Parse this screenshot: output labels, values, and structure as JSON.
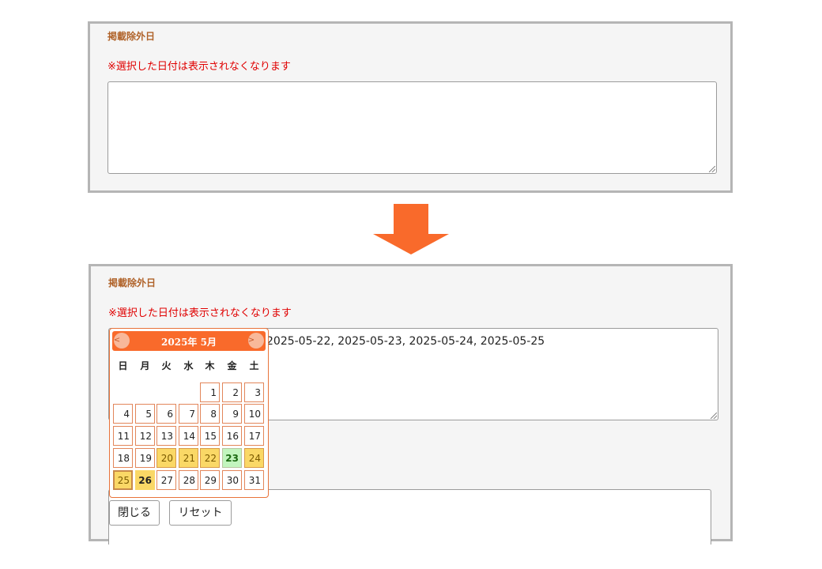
{
  "top_panel": {
    "label": "掲載除外日",
    "note": "※選択した日付は表示されなくなります",
    "textarea_value": ""
  },
  "bottom_panel": {
    "label": "掲載除外日",
    "note": "※選択した日付は表示されなくなります",
    "textarea_value": "2025-05-22, 2025-05-23, 2025-05-24, 2025-05-25"
  },
  "colors": {
    "accent": "#f96a2b",
    "label": "#b0632a",
    "note": "#e00000",
    "selected_day": "#fad866",
    "today": "#c2f5be"
  },
  "calendar": {
    "title": "2025年 5月",
    "prev_label": "<",
    "next_label": ">",
    "weekdays": [
      "日",
      "月",
      "火",
      "水",
      "木",
      "金",
      "土"
    ],
    "weeks": [
      [
        "",
        "",
        "",
        "",
        "1",
        "2",
        "3"
      ],
      [
        "4",
        "5",
        "6",
        "7",
        "8",
        "9",
        "10"
      ],
      [
        "11",
        "12",
        "13",
        "14",
        "15",
        "16",
        "17"
      ],
      [
        "18",
        "19",
        "20",
        "21",
        "22",
        "23",
        "24"
      ],
      [
        "25",
        "26",
        "27",
        "28",
        "29",
        "30",
        "31"
      ]
    ],
    "selected_days": [
      "20",
      "21",
      "22",
      "24"
    ],
    "today": "23",
    "focused_day": "25",
    "highlighted_day": "26"
  },
  "buttons": {
    "close_label": "閉じる",
    "reset_label": "リセット"
  }
}
